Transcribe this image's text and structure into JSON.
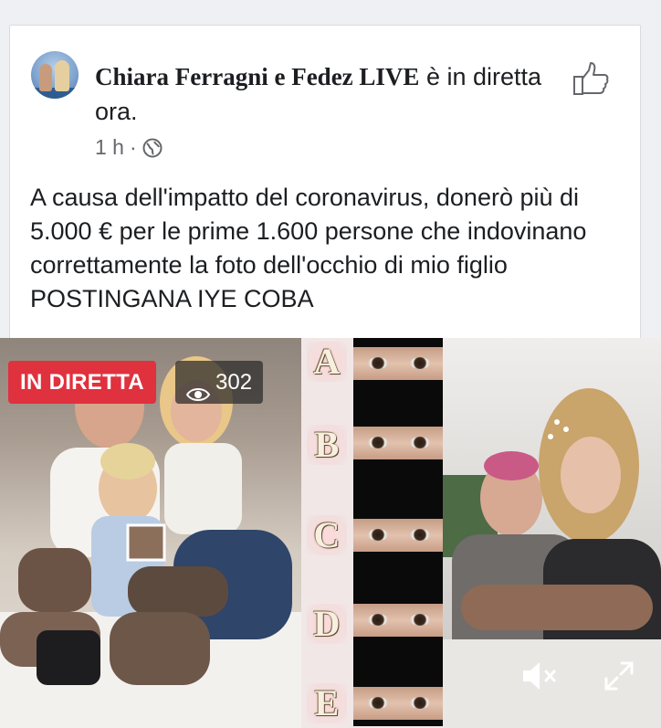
{
  "post": {
    "author": "Chiara Ferragni e Fedez LIVE",
    "action_text": " è in diretta ora.",
    "time": "1 h",
    "separator": "·",
    "privacy_icon": "globe-icon",
    "like_icon": "thumbs-up-icon",
    "text": "A causa dell'impatto del coronavirus, donerò più di 5.000 € per le prime 1.600 persone che indovinano correttamente la foto dell'occhio di mio figlio    POSTINGANA IYE COBA"
  },
  "video": {
    "live_label": "IN DIRETTA",
    "viewer_count": "302",
    "viewer_icon": "eye-icon",
    "mute_icon": "speaker-muted-icon",
    "expand_icon": "expand-icon",
    "options": [
      "A",
      "B",
      "C",
      "D",
      "E"
    ]
  },
  "colors": {
    "live_badge": "#e0313e",
    "text": "#1c1e21",
    "meta": "#65676b"
  }
}
